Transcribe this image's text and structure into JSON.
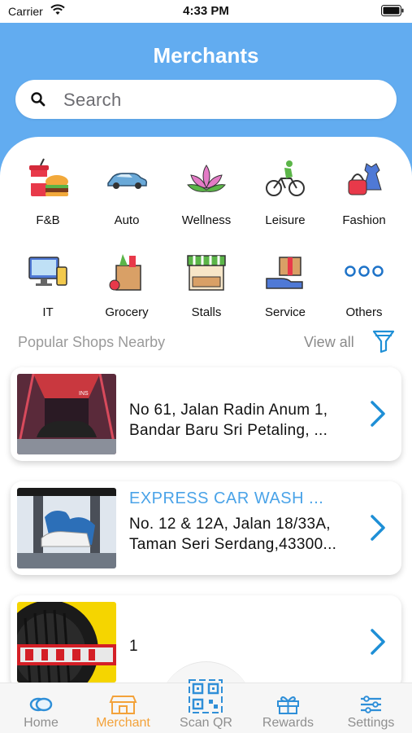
{
  "status_bar": {
    "carrier": "Carrier",
    "time": "4:33 PM"
  },
  "header": {
    "title": "Merchants",
    "search_placeholder": "Search"
  },
  "colors": {
    "header_bg": "#62acf0",
    "accent_blue": "#4aa3e8",
    "active_tab": "#f3a23a",
    "inactive_tab": "#8f8f8f"
  },
  "categories": [
    {
      "label": "F&B",
      "icon": "fnb-icon"
    },
    {
      "label": "Auto",
      "icon": "car-icon"
    },
    {
      "label": "Wellness",
      "icon": "lotus-icon"
    },
    {
      "label": "Leisure",
      "icon": "cyclist-icon"
    },
    {
      "label": "Fashion",
      "icon": "dress-icon"
    },
    {
      "label": "IT",
      "icon": "computer-icon"
    },
    {
      "label": "Grocery",
      "icon": "grocery-bag-icon"
    },
    {
      "label": "Stalls",
      "icon": "stall-icon"
    },
    {
      "label": "Service",
      "icon": "service-box-icon"
    },
    {
      "label": "Others",
      "icon": "more-dots-icon"
    }
  ],
  "popular": {
    "title": "Popular Shops Nearby",
    "view_all": "View all"
  },
  "shops": [
    {
      "name": "",
      "address": "No 61, Jalan Radin Anum 1,\nBandar Baru Sri Petaling, ..."
    },
    {
      "name": "EXPRESS CAR WASH ...",
      "address": "No. 12 & 12A, Jalan 18/33A,\nTaman Seri Serdang,43300..."
    },
    {
      "name": "",
      "address": "1"
    }
  ],
  "tabs": [
    {
      "label": "Home",
      "icon": "home-coins-icon",
      "active": false
    },
    {
      "label": "Merchant",
      "icon": "store-icon",
      "active": true
    },
    {
      "label": "Scan QR",
      "icon": "qr-code-icon",
      "active": false
    },
    {
      "label": "Rewards",
      "icon": "gift-icon",
      "active": false
    },
    {
      "label": "Settings",
      "icon": "sliders-icon",
      "active": false
    }
  ]
}
